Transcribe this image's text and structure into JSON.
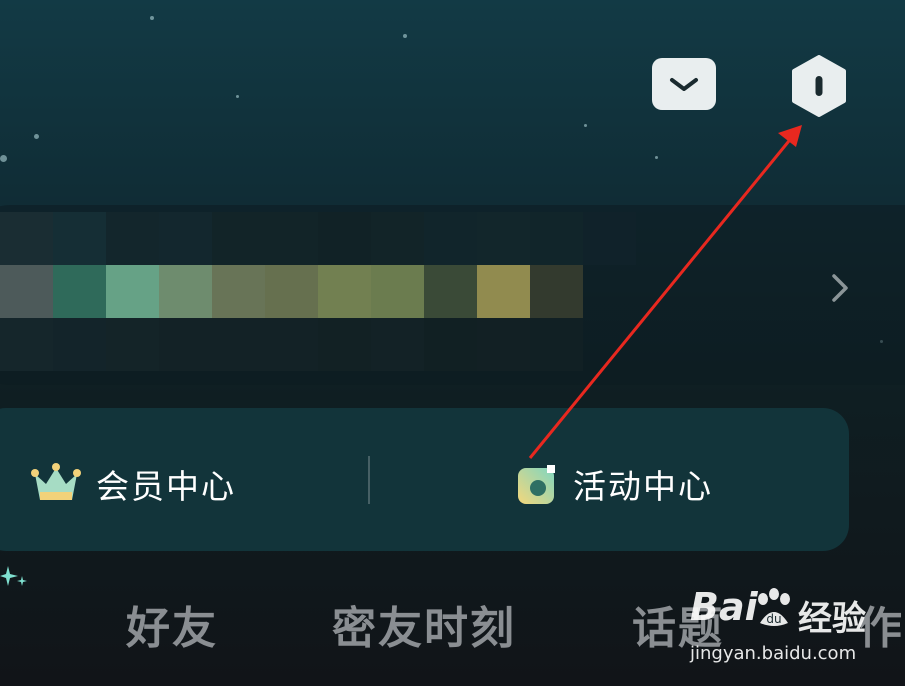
{
  "header": {
    "mail_icon": "envelope-icon",
    "settings_icon": "hexagon-settings-icon"
  },
  "profile": {
    "chevron_icon": "chevron-right-icon"
  },
  "menu": {
    "items": [
      {
        "label": "会员中心",
        "icon": "crown-icon"
      },
      {
        "label": "活动中心",
        "icon": "activity-icon"
      }
    ]
  },
  "tabs": [
    {
      "label": "好友"
    },
    {
      "label": "密友时刻"
    },
    {
      "label": "话题"
    },
    {
      "label": "作"
    }
  ],
  "watermark": {
    "brand": "Bai",
    "text": "经验",
    "url": "jingyan.baidu.com"
  },
  "colors": {
    "annotation_arrow": "#e8281f",
    "menu_panel": "#12343a",
    "tab_text": "#8a8e92"
  }
}
